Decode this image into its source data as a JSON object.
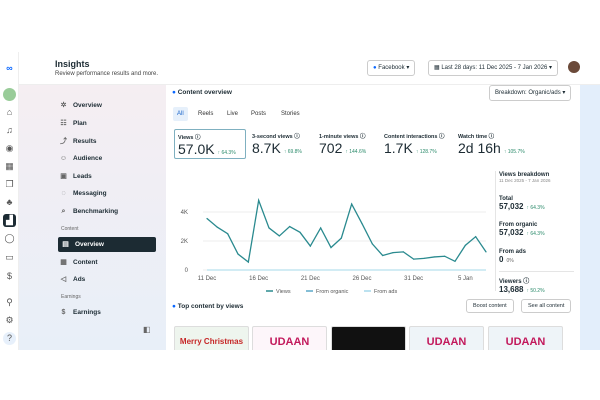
{
  "header": {
    "title": "Insights",
    "subtitle": "Review performance results and more.",
    "platform": "Facebook",
    "date_range": "Last 28 days: 11 Dec 2025 - 7 Jan 2026"
  },
  "rail": {
    "icons": [
      "meta-logo-icon",
      "page-avatar-icon",
      "home-icon",
      "notifications-icon",
      "target-icon",
      "table-icon",
      "pages-icon",
      "gamepad-icon",
      "insights-icon",
      "chat-icon",
      "id-card-icon",
      "dollar-icon",
      "search-icon",
      "settings-icon",
      "help-icon"
    ]
  },
  "sidebar": {
    "items": [
      {
        "label": "Overview",
        "icon": "✲"
      },
      {
        "label": "Plan",
        "icon": "☷"
      },
      {
        "label": "Results",
        "icon": "⤴"
      },
      {
        "label": "Audience",
        "icon": "☺"
      },
      {
        "label": "Leads",
        "icon": "▣"
      },
      {
        "label": "Messaging",
        "icon": "◌"
      },
      {
        "label": "Benchmarking",
        "icon": "⌕"
      }
    ],
    "content_section": "Content",
    "content_items": [
      {
        "label": "Overview",
        "icon": "▤"
      },
      {
        "label": "Content",
        "icon": "▦"
      },
      {
        "label": "Ads",
        "icon": "◁"
      }
    ],
    "earnings_section": "Earnings",
    "earnings_items": [
      {
        "label": "Earnings",
        "icon": "$"
      }
    ]
  },
  "overview": {
    "title": "Content overview",
    "breakdown": "Breakdown: Organic/ads",
    "tabs": [
      "All",
      "Reels",
      "Live",
      "Posts",
      "Stories"
    ],
    "metrics": [
      {
        "label": "Views",
        "value": "57.0K",
        "delta": "↑ 64.3%"
      },
      {
        "label": "3-second views",
        "value": "8.7K",
        "delta": "↑ 69.8%"
      },
      {
        "label": "1-minute views",
        "value": "702",
        "delta": "↑ 144.6%"
      },
      {
        "label": "Content interactions",
        "value": "1.7K",
        "delta": "↑ 128.7%"
      },
      {
        "label": "Watch time",
        "value": "2d 16h",
        "delta": "↑ 105.7%"
      }
    ]
  },
  "breakdown": {
    "title": "Views breakdown",
    "range": "11 Dec 2025 - 7 Jan 2026",
    "total_label": "Total",
    "total": "57,032",
    "total_delta": "↑ 64.3%",
    "organic_label": "From organic",
    "organic": "57,032",
    "organic_delta": "↑ 64.3%",
    "ads_label": "From ads",
    "ads": "0",
    "ads_delta": "0%",
    "viewers_label": "Viewers",
    "viewers": "13,688",
    "viewers_delta": "↑ 50.2%"
  },
  "chart_data": {
    "type": "line",
    "x_tick_labels": [
      "11 Dec",
      "16 Dec",
      "21 Dec",
      "26 Dec",
      "31 Dec",
      "5 Jan"
    ],
    "y_tick_labels": [
      "0",
      "2K",
      "4K"
    ],
    "ylim": [
      0,
      5000
    ],
    "grid": true,
    "legend_placement": "bottom",
    "series": [
      {
        "name": "Views",
        "color": "#2a8a8f",
        "values": [
          3550,
          2950,
          2500,
          1100,
          550,
          4800,
          2900,
          2350,
          3000,
          2600,
          1650,
          2900,
          1550,
          2200,
          4550,
          3200,
          1800,
          1000,
          1200,
          1250,
          750,
          800,
          900,
          950,
          600,
          1700,
          2300,
          1250
        ]
      },
      {
        "name": "From organic",
        "color": "#5aa9c9",
        "values": []
      },
      {
        "name": "From ads",
        "color": "#a6d8ea",
        "values": [
          0,
          0,
          0,
          0,
          0,
          0,
          0,
          0,
          0,
          0,
          0,
          0,
          0,
          0,
          0,
          0,
          0,
          0,
          0,
          0,
          0,
          0,
          0,
          0,
          0,
          0,
          0,
          0
        ]
      }
    ]
  },
  "top_content": {
    "title": "Top content by views",
    "boost": "Boost content",
    "see_all": "See all content",
    "thumbs": [
      "Merry Christmas",
      "UDAAN",
      "",
      "UDAAN",
      "UDAAN"
    ]
  }
}
